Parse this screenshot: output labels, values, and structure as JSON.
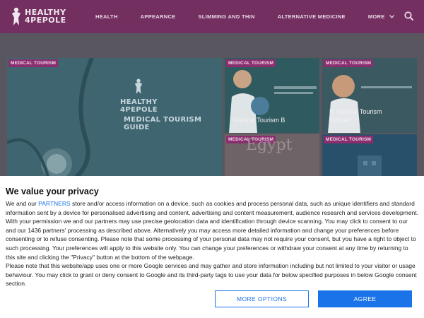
{
  "site": {
    "logo_line1": "HEALTHY",
    "logo_line2": "4PEPOLE"
  },
  "nav": {
    "items": [
      "HEALTH",
      "APPEARNCE",
      "SLIMMING AND THIN",
      "ALTERNATIVE MEDICINE"
    ],
    "more_label": "MORE"
  },
  "hero": {
    "big": {
      "badge": "MEDICAL TOURISM",
      "logo_line1": "HEALTHY",
      "logo_line2": "4PEPOLE",
      "guide_text": "MEDICAL TOURISM GUIDE"
    },
    "tiles": [
      {
        "badge": "MEDICAL TOURISM",
        "title": "Medical Tourism B"
      },
      {
        "badge": "MEDICAL TOURISM",
        "title": "Is Medical Tourism Ethical?"
      },
      {
        "badge": "MEDICAL TOURISM",
        "title": "Egypt"
      },
      {
        "badge": "MEDICAL TOURISM",
        "title": ""
      }
    ]
  },
  "consent": {
    "title": "We value your privacy",
    "body_prefix": "We and our ",
    "partners_link": "PARTNERS",
    "body_p1": " store and/or access information on a device, such as cookies and process personal data, such as unique identifiers and standard information sent by a device for personalised advertising and content, advertising and content measurement, audience research and services development. With your permission we and our partners may use precise geolocation data and identification through device scanning. You may click to consent to our and our 1436 partners' processing as described above. Alternatively you may access more detailed information and change your preferences before consenting or to refuse consenting. Please note that some processing of your personal data may not require your consent, but you have a right to object to such processing. Your preferences will apply to this website only. You can change your preferences or withdraw your consent at any time by returning to this site and clicking the \"Privacy\" button at the bottom of the webpage.",
    "body_p2": "Please note that this website/app uses one or more Google services and may gather and store information including but not limited to your visitor or usage behaviour. You may click to grant or deny consent to Google and its third-party tags to use your data for below specified purposes in below Google consent section.",
    "more_options_label": "MORE OPTIONS",
    "agree_label": "AGREE"
  },
  "colors": {
    "header_bg": "#742f61",
    "badge_bg": "#8a2e6f",
    "button_blue": "#1a73e8"
  },
  "icons": {
    "logo": "person-leaf-icon",
    "search": "search-icon",
    "more": "chevron-down-icon"
  }
}
